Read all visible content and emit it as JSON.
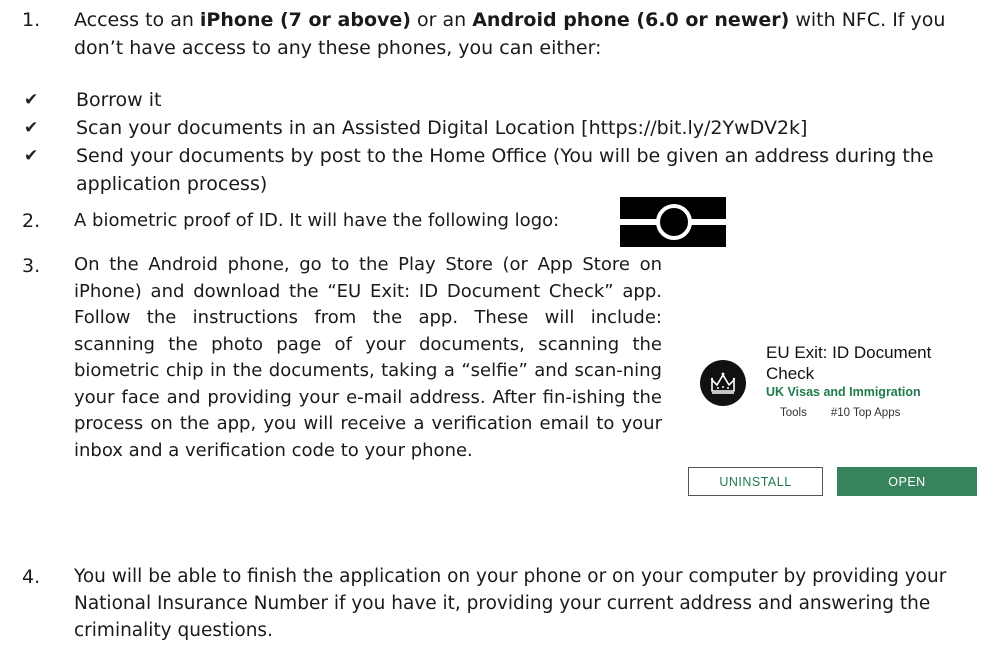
{
  "items": [
    {
      "number": "1.",
      "text_before": "Access to an ",
      "bold_1": "iPhone (7 or above)",
      "text_mid": " or an ",
      "bold_2": "Android phone (6.0 or newer)",
      "text_after": " with NFC.  If you don’t have access to any these phones, you can either:"
    },
    {
      "number": "2.",
      "text": "A biometric proof of ID. It will have the following logo:"
    },
    {
      "number": "3.",
      "text": "On the Android phone, go to the Play Store (or App Store on iPhone) and download the “EU Exit: ID Document Check” app. Follow the instructions from the app. These will include: scanning the photo page of your documents, scanning the biometric chip in the documents, taking a “selfie” and scan-ning your face and providing your e-mail address. After fin-ishing the process on the app, you will receive a verification email to your inbox and a verification code to your phone."
    },
    {
      "number": "4.",
      "text": "You will be able to finish the application on your phone or on your computer by providing your National Insurance Number if you have it, providing your current address and answering the criminality questions."
    }
  ],
  "bullets": [
    {
      "mark": "✔",
      "text": "Borrow it"
    },
    {
      "mark": "✔",
      "text": "Scan your documents in an Assisted Digital Location [https://bit.ly/2YwDV2k]"
    },
    {
      "mark": "✔",
      "text": "Send your documents by post to the Home Office (You will be given an address during the application process)"
    }
  ],
  "app_card": {
    "title": "EU Exit: ID Document Check",
    "developer": "UK Visas and Immigration",
    "category": "Tools",
    "rank": "#10 Top Apps",
    "uninstall_label": "UNINSTALL",
    "open_label": "OPEN",
    "accent_color": "#37845c",
    "icon": "crown-icon"
  },
  "logo": {
    "icon": "biometric-chip-logo"
  }
}
